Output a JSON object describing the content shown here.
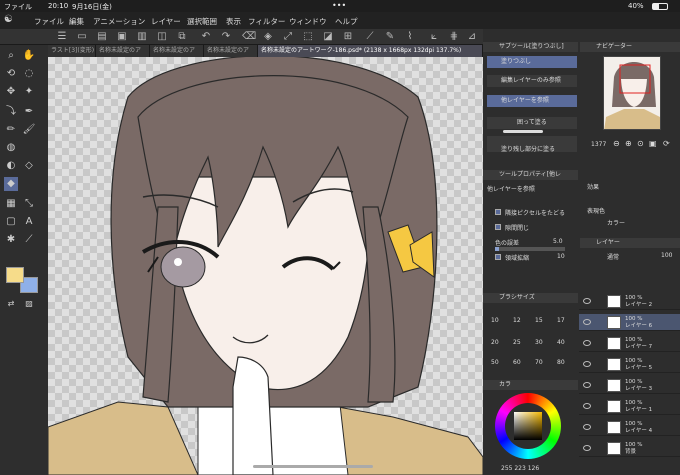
{
  "status": {
    "app": "ファイル",
    "time": "20:10",
    "date": "9月16日(金)",
    "battery": "40%"
  },
  "menu": [
    "ファイル",
    "編集",
    "アニメーション",
    "レイヤー",
    "選択範囲",
    "表示",
    "フィルター",
    "ウィンドウ",
    "ヘルプ"
  ],
  "tabs": [
    "ラスト[3](変形)",
    "名称未設定のア",
    "名称未設定のア",
    "名称未設定のア",
    "名称未設定のアートワーク-186.psd* (2138 x 1668px 132dpi 137.7%)"
  ],
  "subtool": {
    "title": "サブツール[塗りつぶし]",
    "items": [
      "塗りつぶし",
      "編集レイヤーのみ参照",
      "他レイヤーを参照",
      "囲って塗る",
      "塗り残し部分に塗る"
    ]
  },
  "navigator": {
    "title": "ナビゲーター",
    "zoom": "1377"
  },
  "toolprop": {
    "title": "ツールプロパティ[他レ",
    "mode": "他レイヤーを参照",
    "opt1": "隣接ピクセルをたどる",
    "opt2": "隙間閉じ",
    "gap_label": "色の誤差",
    "gap_value": "5.0",
    "expand_label": "領域拡縮",
    "expand_value": "10"
  },
  "effect": {
    "title": "効果",
    "display_color": "表現色",
    "color_mode": "カラー"
  },
  "layers": {
    "title": "レイヤー",
    "blend": "通常",
    "opacity": "100",
    "items": [
      {
        "pct": "100 %",
        "name": "レイヤー 2",
        "sel": false
      },
      {
        "pct": "100 %",
        "name": "レイヤー 6",
        "sel": true
      },
      {
        "pct": "100 %",
        "name": "レイヤー 7",
        "sel": false
      },
      {
        "pct": "100 %",
        "name": "レイヤー 5",
        "sel": false
      },
      {
        "pct": "100 %",
        "name": "レイヤー 3",
        "sel": false
      },
      {
        "pct": "100 %",
        "name": "レイヤー 1",
        "sel": false
      },
      {
        "pct": "100 %",
        "name": "レイヤー 4",
        "sel": false
      },
      {
        "pct": "100 %",
        "name": "背景",
        "sel": false
      }
    ]
  },
  "brush_size": {
    "title": "ブラシサイズ",
    "sizes": [
      "10",
      "12",
      "15",
      "17",
      "20",
      "25",
      "30",
      "40",
      "50",
      "60",
      "70",
      "80"
    ]
  },
  "color": {
    "title": "カラ",
    "rgb": "255 223 126"
  },
  "colors": {
    "main": "#f6dc8a",
    "sub": "#8fb0e8",
    "hair": "#7a6a66",
    "skin": "#f8efea",
    "jacket": "#d8bd8a",
    "bow": "#f5c842",
    "iris": "#a59aa2"
  }
}
